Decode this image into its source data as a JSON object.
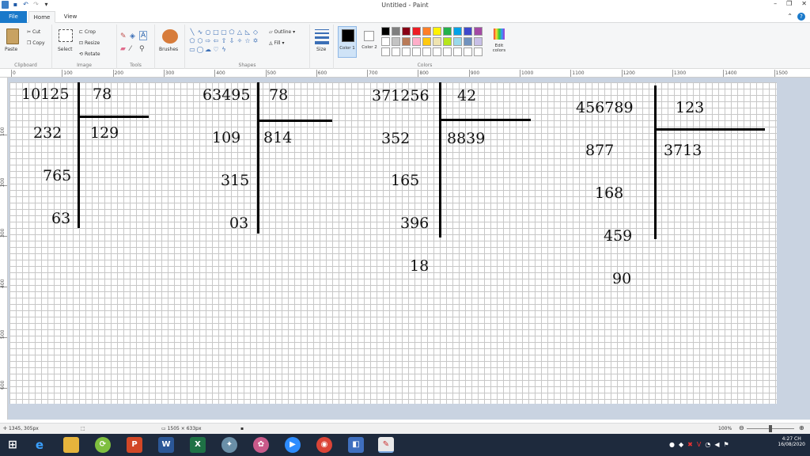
{
  "window": {
    "title": "Untitled - Paint"
  },
  "menu": {
    "file": "File",
    "home": "Home",
    "view": "View"
  },
  "ribbon": {
    "clipboard": {
      "label": "Clipboard",
      "paste": "Paste",
      "cut": "Cut",
      "copy": "Copy"
    },
    "image": {
      "label": "Image",
      "select": "Select",
      "crop": "Crop",
      "resize": "Resize",
      "rotate": "Rotate"
    },
    "tools": {
      "label": "Tools"
    },
    "brushes": {
      "label": "Brushes"
    },
    "shapes": {
      "label": "Shapes",
      "outline": "Outline",
      "fill": "Fill"
    },
    "size": {
      "label": "Size"
    },
    "colors": {
      "label": "Colors",
      "color1": "Color 1",
      "color2": "Color 2",
      "edit": "Edit colors",
      "palette": [
        "#000000",
        "#7f7f7f",
        "#880015",
        "#ed1c24",
        "#ff7f27",
        "#fff200",
        "#22b14c",
        "#00a2e8",
        "#3f48cc",
        "#a349a4",
        "#ffffff",
        "#c3c3c3",
        "#b97a57",
        "#ffaec9",
        "#ffc90e",
        "#efe4b0",
        "#b5e61d",
        "#99d9ea",
        "#7092be",
        "#c8bfe7",
        "#ffffff",
        "#ffffff",
        "#ffffff",
        "#ffffff",
        "#ffffff",
        "#ffffff",
        "#ffffff",
        "#ffffff",
        "#ffffff",
        "#ffffff"
      ],
      "color1_value": "#000000",
      "color2_value": "#ffffff"
    }
  },
  "ruler": {
    "x_labels": [
      "0",
      "100",
      "200",
      "300",
      "400",
      "500",
      "600",
      "700",
      "800",
      "900",
      "1000",
      "1100",
      "1200",
      "1300",
      "1400",
      "1500"
    ],
    "y_labels": [
      "100",
      "200",
      "300",
      "400",
      "500",
      "600"
    ]
  },
  "canvas": {
    "divisions": [
      {
        "dividend": "10125",
        "divisor": "78",
        "quotient": "129",
        "steps": [
          "232",
          "765",
          "63"
        ]
      },
      {
        "dividend": "63495",
        "divisor": "78",
        "quotient": "814",
        "steps": [
          "109",
          "315",
          "03"
        ]
      },
      {
        "dividend": "371256",
        "divisor": "42",
        "quotient": "8839",
        "steps": [
          "352",
          "165",
          "396",
          "18"
        ]
      },
      {
        "dividend": "456789",
        "divisor": "123",
        "quotient": "3713",
        "steps": [
          "877",
          "168",
          "459",
          "90"
        ]
      }
    ]
  },
  "status": {
    "cursor": "1345, 305px",
    "canvas_size": "1505 × 633px",
    "zoom": "100%"
  },
  "taskbar": {
    "time": "4:27 CH",
    "date": "16/08/2020"
  }
}
